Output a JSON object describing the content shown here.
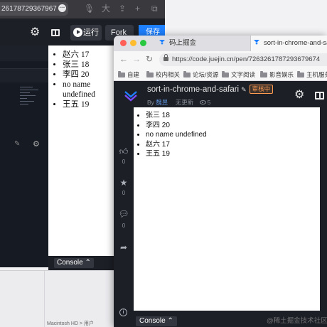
{
  "bg_window": {
    "url_snippet": "26178729367967",
    "toolbar": {
      "run_label": "运行",
      "fork_label": "Fork",
      "save_label": "保存"
    },
    "preview_list": [
      "赵六 17",
      "张三 18",
      "李四 20",
      "no name undefined",
      "王五 19"
    ],
    "console_label": "Console ⌃",
    "finder_path": "Macintosh HD > 用户"
  },
  "fg_window": {
    "tabs": [
      {
        "label": "码上掘金"
      },
      {
        "label": "sort-in-chrome-and-safari"
      }
    ],
    "url": "https://code.juejin.cn/pen/7263261787293679674",
    "bookmarks": [
      "自建",
      "校内相关",
      "论坛/资源",
      "文字阅读",
      "影音娱乐",
      "主机服务"
    ],
    "pen": {
      "title": "sort-in-chrome-and-safari",
      "badge": "审核中",
      "by_label": "By",
      "author": "魏昱",
      "updated": "无更新",
      "views": "5"
    },
    "sidebar": {
      "like_count": "0",
      "star_count": "0",
      "comment_count": "0"
    },
    "preview_list": [
      "张三 18",
      "李四 20",
      "no name undefined",
      "赵六 17",
      "王五 19"
    ],
    "console_label": "Console ⌃"
  },
  "watermark": "@稀土掘金技术社区",
  "colors": {
    "accent_blue": "#1e80ff",
    "dark_bg": "#1c1f26",
    "badge_orange": "#ff9c52"
  }
}
